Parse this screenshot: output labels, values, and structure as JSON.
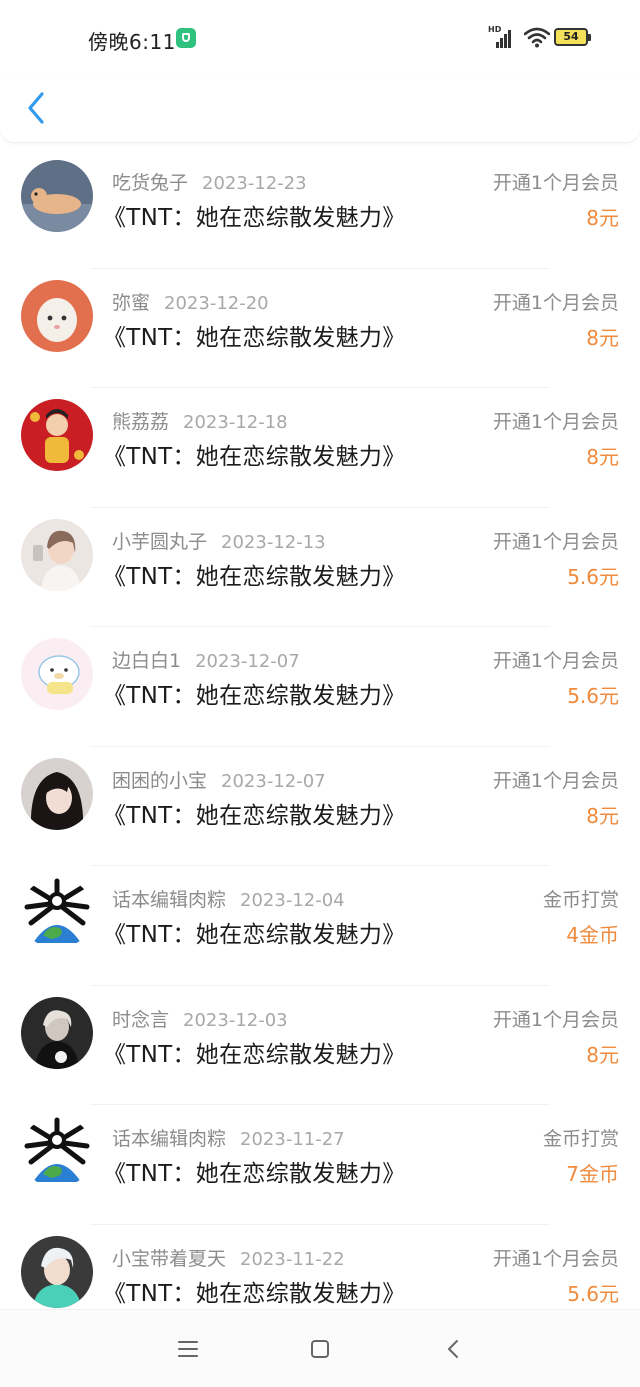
{
  "status_bar": {
    "time": "傍晚6:11",
    "battery": "54",
    "network": "HD"
  },
  "header": {
    "back_icon": "chevron-left-icon"
  },
  "records": [
    {
      "name": "吃货兔子",
      "date": "2023-12-23",
      "title": "《TNT：她在恋综散发魅力》",
      "kind": "开通1个月会员",
      "amount": "8元"
    },
    {
      "name": "弥蜜",
      "date": "2023-12-20",
      "title": "《TNT：她在恋综散发魅力》",
      "kind": "开通1个月会员",
      "amount": "8元"
    },
    {
      "name": "熊荔荔",
      "date": "2023-12-18",
      "title": "《TNT：她在恋综散发魅力》",
      "kind": "开通1个月会员",
      "amount": "8元"
    },
    {
      "name": "小芋圆丸子",
      "date": "2023-12-13",
      "title": "《TNT：她在恋综散发魅力》",
      "kind": "开通1个月会员",
      "amount": "5.6元"
    },
    {
      "name": "边白白1",
      "date": "2023-12-07",
      "title": "《TNT：她在恋综散发魅力》",
      "kind": "开通1个月会员",
      "amount": "5.6元"
    },
    {
      "name": "困困的小宝",
      "date": "2023-12-07",
      "title": "《TNT：她在恋综散发魅力》",
      "kind": "开通1个月会员",
      "amount": "8元"
    },
    {
      "name": "话本编辑肉粽",
      "date": "2023-12-04",
      "title": "《TNT：她在恋综散发魅力》",
      "kind": "金币打赏",
      "amount": "4金币"
    },
    {
      "name": "时念言",
      "date": "2023-12-03",
      "title": "《TNT：她在恋综散发魅力》",
      "kind": "开通1个月会员",
      "amount": "8元"
    },
    {
      "name": "话本编辑肉粽",
      "date": "2023-11-27",
      "title": "《TNT：她在恋综散发魅力》",
      "kind": "金币打赏",
      "amount": "7金币"
    },
    {
      "name": "小宝带着夏天",
      "date": "2023-11-22",
      "title": "《TNT：她在恋综散发魅力》",
      "kind": "开通1个月会员",
      "amount": "5.6元"
    }
  ],
  "colors": {
    "accent": "#2f9bf0",
    "amount": "#f08a3c",
    "muted": "#8c8c8c"
  },
  "system_nav": {
    "menu_icon": "menu-icon",
    "home_icon": "home-square-icon",
    "back_icon": "back-triangle-icon"
  }
}
